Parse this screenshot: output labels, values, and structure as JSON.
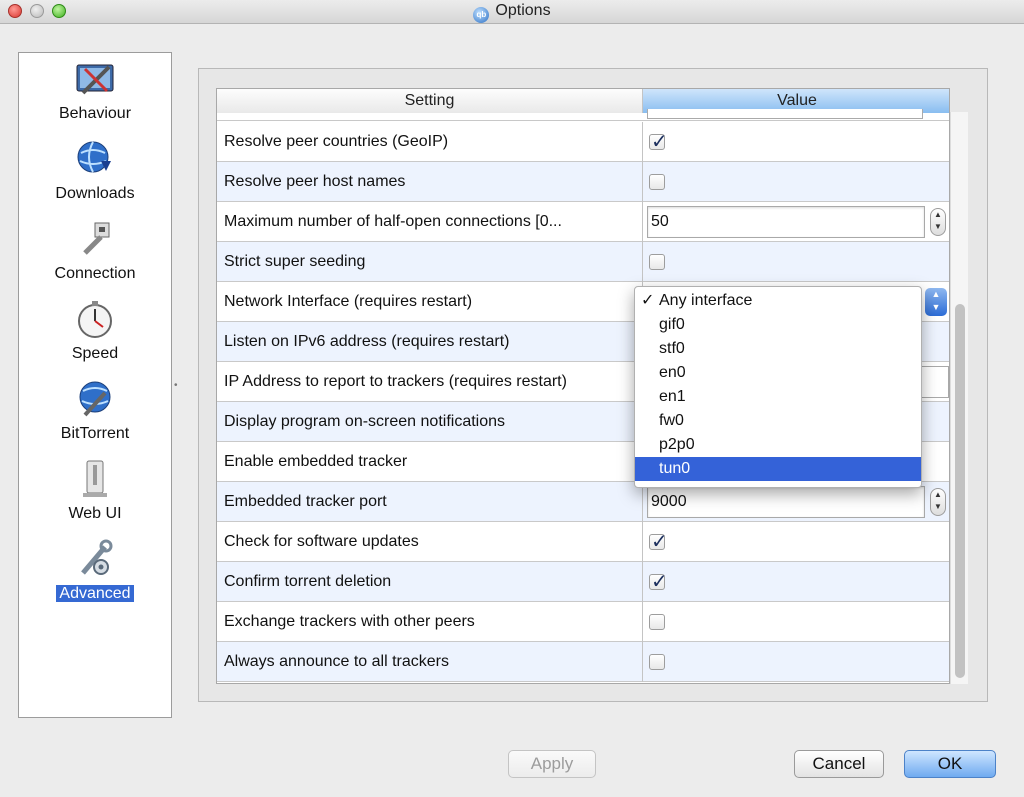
{
  "window": {
    "title": "Options"
  },
  "sidebar": {
    "items": [
      {
        "label": "Behaviour",
        "icon": "behaviour-icon",
        "active": false
      },
      {
        "label": "Downloads",
        "icon": "downloads-globe-icon",
        "active": false
      },
      {
        "label": "Connection",
        "icon": "connection-plug-icon",
        "active": false
      },
      {
        "label": "Speed",
        "icon": "speed-stopwatch-icon",
        "active": false
      },
      {
        "label": "BitTorrent",
        "icon": "bittorrent-globe-icon",
        "active": false
      },
      {
        "label": "Web UI",
        "icon": "webui-tower-icon",
        "active": false
      },
      {
        "label": "Advanced",
        "icon": "advanced-tools-icon",
        "active": true
      }
    ]
  },
  "table": {
    "headers": {
      "setting": "Setting",
      "value": "Value"
    },
    "rows": [
      {
        "setting": "Resolve peer countries (GeoIP)",
        "type": "checkbox",
        "checked": true
      },
      {
        "setting": "Resolve peer host names",
        "type": "checkbox",
        "checked": false
      },
      {
        "setting": "Maximum number of half-open connections [0...",
        "type": "spinbox",
        "value": "50"
      },
      {
        "setting": "Strict super seeding",
        "type": "checkbox",
        "checked": false
      },
      {
        "setting": "Network Interface (requires restart)",
        "type": "combo",
        "value": "Any interface"
      },
      {
        "setting": "Listen on IPv6 address (requires restart)",
        "type": "checkbox",
        "checked": false
      },
      {
        "setting": "IP Address to report to trackers (requires restart)",
        "type": "text",
        "value": ""
      },
      {
        "setting": "Display program on-screen notifications",
        "type": "checkbox",
        "checked": false
      },
      {
        "setting": "Enable embedded tracker",
        "type": "checkbox",
        "checked": false
      },
      {
        "setting": "Embedded tracker port",
        "type": "spinbox",
        "value": "9000"
      },
      {
        "setting": "Check for software updates",
        "type": "checkbox",
        "checked": true
      },
      {
        "setting": "Confirm torrent deletion",
        "type": "checkbox",
        "checked": true
      },
      {
        "setting": "Exchange trackers with other peers",
        "type": "checkbox",
        "checked": false
      },
      {
        "setting": "Always announce to all trackers",
        "type": "checkbox",
        "checked": false
      }
    ]
  },
  "dropdown": {
    "options": [
      "Any interface",
      "gif0",
      "stf0",
      "en0",
      "en1",
      "fw0",
      "p2p0",
      "tun0"
    ],
    "checked_index": 0,
    "highlighted_index": 7
  },
  "buttons": {
    "apply": "Apply",
    "cancel": "Cancel",
    "ok": "OK"
  },
  "colors": {
    "selection": "#3462d8",
    "header_value": "#89bdf0",
    "row_alt": "#edf3fe"
  }
}
